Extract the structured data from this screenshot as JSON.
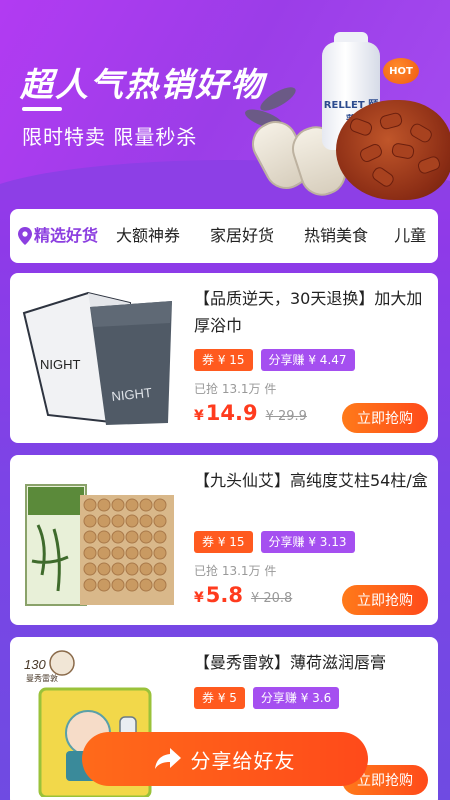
{
  "banner": {
    "title": "超人气热销好物",
    "subtitle": "限时特卖 限量秒杀",
    "bottle_label": "RELLET 颐莲",
    "hot_badge": "HOT"
  },
  "tabs": [
    {
      "label": "精选好货",
      "active": true
    },
    {
      "label": "大额神券",
      "active": false
    },
    {
      "label": "家居好货",
      "active": false
    },
    {
      "label": "热销美食",
      "active": false
    },
    {
      "label": "儿童",
      "active": false
    }
  ],
  "products": [
    {
      "title": "【品质逆天，30天退换】加大加厚浴巾",
      "coupon": "券 ¥ 15",
      "share": "分享赚 ¥ 4.47",
      "sold": "已抢 13.1万 件",
      "currency": "¥",
      "price": "14.9",
      "original_price": "¥ 29.9",
      "buy_label": "立即抢购",
      "image_text": [
        "NIGHT",
        "NIGHT"
      ]
    },
    {
      "title": "【九头仙艾】高纯度艾柱54柱/盒",
      "coupon": "券 ¥ 15",
      "share": "分享赚 ¥ 3.13",
      "sold": "已抢 13.1万 件",
      "currency": "¥",
      "price": "5.8",
      "original_price": "¥ 20.8",
      "buy_label": "立即抢购"
    },
    {
      "title": "【曼秀雷敦】薄荷滋润唇膏",
      "coupon": "券 ¥ 5",
      "share": "分享赚 ¥ 3.6",
      "buy_label": "立即抢购",
      "image_text": [
        "130",
        "曼秀雷敦"
      ]
    }
  ],
  "share_button": "分享给好友",
  "colors": {
    "accent": "#8c3fe0",
    "price": "#ff3b1e",
    "coupon": "#ff5a1f",
    "share_chip": "#a54ff0",
    "button": "#ff5a1a"
  }
}
